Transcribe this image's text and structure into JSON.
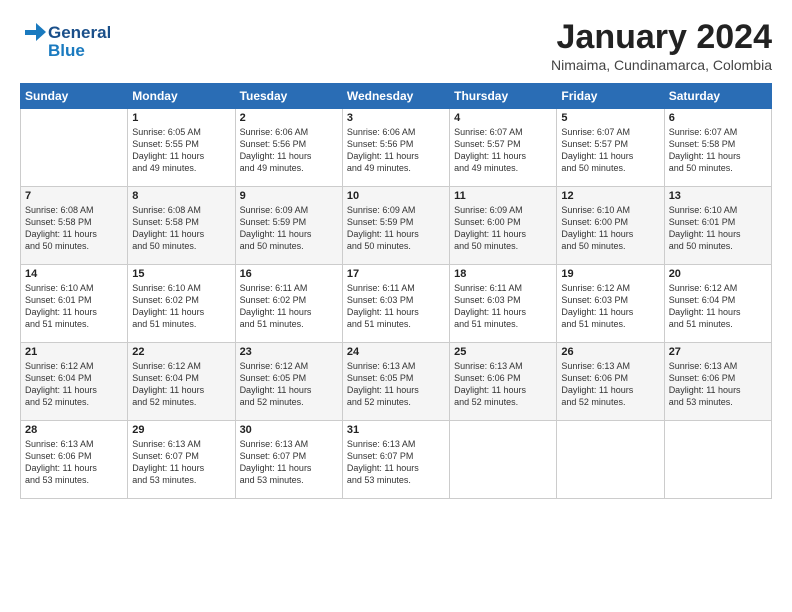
{
  "logo": {
    "line1": "General",
    "line2": "Blue"
  },
  "title": "January 2024",
  "subtitle": "Nimaima, Cundinamarca, Colombia",
  "headers": [
    "Sunday",
    "Monday",
    "Tuesday",
    "Wednesday",
    "Thursday",
    "Friday",
    "Saturday"
  ],
  "weeks": [
    [
      {
        "num": "",
        "info": ""
      },
      {
        "num": "1",
        "info": "Sunrise: 6:05 AM\nSunset: 5:55 PM\nDaylight: 11 hours\nand 49 minutes."
      },
      {
        "num": "2",
        "info": "Sunrise: 6:06 AM\nSunset: 5:56 PM\nDaylight: 11 hours\nand 49 minutes."
      },
      {
        "num": "3",
        "info": "Sunrise: 6:06 AM\nSunset: 5:56 PM\nDaylight: 11 hours\nand 49 minutes."
      },
      {
        "num": "4",
        "info": "Sunrise: 6:07 AM\nSunset: 5:57 PM\nDaylight: 11 hours\nand 49 minutes."
      },
      {
        "num": "5",
        "info": "Sunrise: 6:07 AM\nSunset: 5:57 PM\nDaylight: 11 hours\nand 50 minutes."
      },
      {
        "num": "6",
        "info": "Sunrise: 6:07 AM\nSunset: 5:58 PM\nDaylight: 11 hours\nand 50 minutes."
      }
    ],
    [
      {
        "num": "7",
        "info": "Sunrise: 6:08 AM\nSunset: 5:58 PM\nDaylight: 11 hours\nand 50 minutes."
      },
      {
        "num": "8",
        "info": "Sunrise: 6:08 AM\nSunset: 5:58 PM\nDaylight: 11 hours\nand 50 minutes."
      },
      {
        "num": "9",
        "info": "Sunrise: 6:09 AM\nSunset: 5:59 PM\nDaylight: 11 hours\nand 50 minutes."
      },
      {
        "num": "10",
        "info": "Sunrise: 6:09 AM\nSunset: 5:59 PM\nDaylight: 11 hours\nand 50 minutes."
      },
      {
        "num": "11",
        "info": "Sunrise: 6:09 AM\nSunset: 6:00 PM\nDaylight: 11 hours\nand 50 minutes."
      },
      {
        "num": "12",
        "info": "Sunrise: 6:10 AM\nSunset: 6:00 PM\nDaylight: 11 hours\nand 50 minutes."
      },
      {
        "num": "13",
        "info": "Sunrise: 6:10 AM\nSunset: 6:01 PM\nDaylight: 11 hours\nand 50 minutes."
      }
    ],
    [
      {
        "num": "14",
        "info": "Sunrise: 6:10 AM\nSunset: 6:01 PM\nDaylight: 11 hours\nand 51 minutes."
      },
      {
        "num": "15",
        "info": "Sunrise: 6:10 AM\nSunset: 6:02 PM\nDaylight: 11 hours\nand 51 minutes."
      },
      {
        "num": "16",
        "info": "Sunrise: 6:11 AM\nSunset: 6:02 PM\nDaylight: 11 hours\nand 51 minutes."
      },
      {
        "num": "17",
        "info": "Sunrise: 6:11 AM\nSunset: 6:03 PM\nDaylight: 11 hours\nand 51 minutes."
      },
      {
        "num": "18",
        "info": "Sunrise: 6:11 AM\nSunset: 6:03 PM\nDaylight: 11 hours\nand 51 minutes."
      },
      {
        "num": "19",
        "info": "Sunrise: 6:12 AM\nSunset: 6:03 PM\nDaylight: 11 hours\nand 51 minutes."
      },
      {
        "num": "20",
        "info": "Sunrise: 6:12 AM\nSunset: 6:04 PM\nDaylight: 11 hours\nand 51 minutes."
      }
    ],
    [
      {
        "num": "21",
        "info": "Sunrise: 6:12 AM\nSunset: 6:04 PM\nDaylight: 11 hours\nand 52 minutes."
      },
      {
        "num": "22",
        "info": "Sunrise: 6:12 AM\nSunset: 6:04 PM\nDaylight: 11 hours\nand 52 minutes."
      },
      {
        "num": "23",
        "info": "Sunrise: 6:12 AM\nSunset: 6:05 PM\nDaylight: 11 hours\nand 52 minutes."
      },
      {
        "num": "24",
        "info": "Sunrise: 6:13 AM\nSunset: 6:05 PM\nDaylight: 11 hours\nand 52 minutes."
      },
      {
        "num": "25",
        "info": "Sunrise: 6:13 AM\nSunset: 6:06 PM\nDaylight: 11 hours\nand 52 minutes."
      },
      {
        "num": "26",
        "info": "Sunrise: 6:13 AM\nSunset: 6:06 PM\nDaylight: 11 hours\nand 52 minutes."
      },
      {
        "num": "27",
        "info": "Sunrise: 6:13 AM\nSunset: 6:06 PM\nDaylight: 11 hours\nand 53 minutes."
      }
    ],
    [
      {
        "num": "28",
        "info": "Sunrise: 6:13 AM\nSunset: 6:06 PM\nDaylight: 11 hours\nand 53 minutes."
      },
      {
        "num": "29",
        "info": "Sunrise: 6:13 AM\nSunset: 6:07 PM\nDaylight: 11 hours\nand 53 minutes."
      },
      {
        "num": "30",
        "info": "Sunrise: 6:13 AM\nSunset: 6:07 PM\nDaylight: 11 hours\nand 53 minutes."
      },
      {
        "num": "31",
        "info": "Sunrise: 6:13 AM\nSunset: 6:07 PM\nDaylight: 11 hours\nand 53 minutes."
      },
      {
        "num": "",
        "info": ""
      },
      {
        "num": "",
        "info": ""
      },
      {
        "num": "",
        "info": ""
      }
    ]
  ]
}
